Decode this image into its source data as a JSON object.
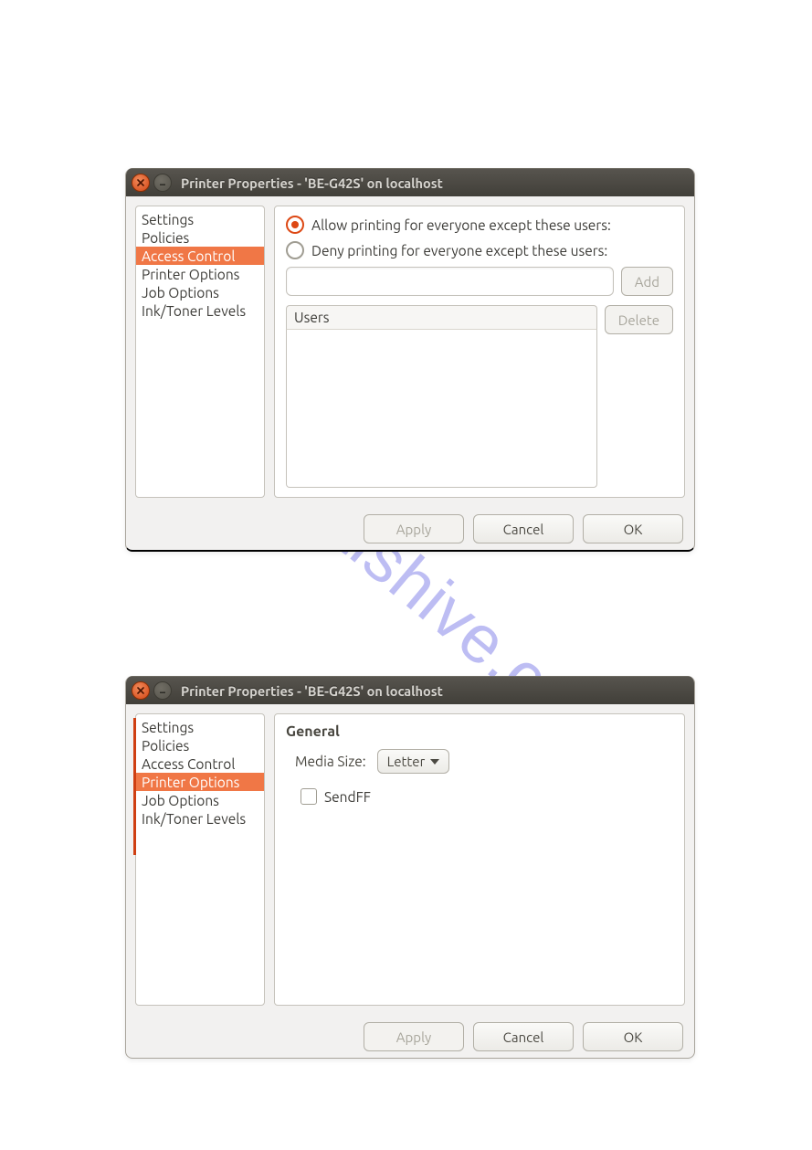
{
  "watermark_text": "manualshive.com",
  "window1": {
    "title": "Printer Properties - 'BE-G42S' on localhost",
    "sidebar": [
      "Settings",
      "Policies",
      "Access Control",
      "Printer Options",
      "Job Options",
      "Ink/Toner Levels"
    ],
    "sidebar_selected_index": 2,
    "radio_allow_label": "Allow printing for everyone except these users:",
    "radio_deny_label": "Deny printing for everyone except these users:",
    "radio_selected": "allow",
    "add_user_value": "",
    "add_button": "Add",
    "users_header": "Users",
    "delete_button": "Delete",
    "footer": {
      "apply": "Apply",
      "cancel": "Cancel",
      "ok": "OK"
    }
  },
  "window2": {
    "title": "Printer Properties - 'BE-G42S' on localhost",
    "sidebar": [
      "Settings",
      "Policies",
      "Access Control",
      "Printer Options",
      "Job Options",
      "Ink/Toner Levels"
    ],
    "sidebar_selected_index": 3,
    "section_title": "General",
    "media_size_label": "Media Size:",
    "media_size_value": "Letter",
    "sendff_label": "SendFF",
    "sendff_checked": false,
    "footer": {
      "apply": "Apply",
      "cancel": "Cancel",
      "ok": "OK"
    }
  }
}
